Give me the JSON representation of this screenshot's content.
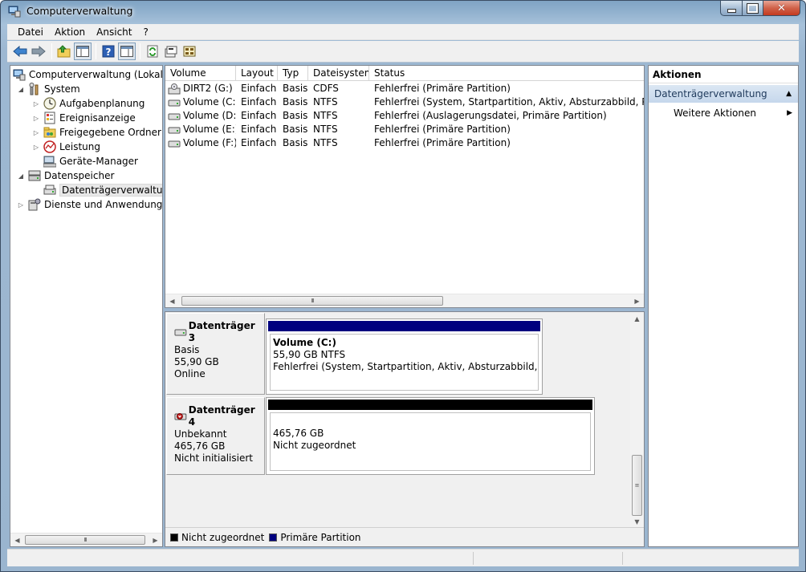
{
  "window": {
    "title": "Computerverwaltung",
    "colors": {
      "frame": "#9ab5cf",
      "close": "#c43a20",
      "primary_partition": "#00007f",
      "unallocated": "#000000"
    }
  },
  "menu": [
    "Datei",
    "Aktion",
    "Ansicht",
    "?"
  ],
  "toolbar": {
    "buttons": [
      "back-arrow-icon",
      "forward-arrow-icon",
      "up-folder-icon",
      "show-hide-tree-icon",
      "help-icon",
      "view-icon",
      "refresh-icon",
      "properties-icon",
      "disk-settings-icon"
    ]
  },
  "tree": {
    "root": "Computerverwaltung (Lokal)",
    "system": "System",
    "aufgabenplanung": "Aufgabenplanung",
    "ereignisanzeige": "Ereignisanzeige",
    "freigegebene_ordner": "Freigegebene Ordner",
    "leistung": "Leistung",
    "geraete_manager": "Geräte-Manager",
    "datenspeicher": "Datenspeicher",
    "datentraegerverwaltung": "Datenträgerverwaltung",
    "dienste": "Dienste und Anwendungen"
  },
  "volumes": {
    "columns": [
      "Volume",
      "Layout",
      "Typ",
      "Dateisystem",
      "Status"
    ],
    "rows": [
      [
        "DIRT2 (G:)",
        "Einfach",
        "Basis",
        "CDFS",
        "Fehlerfrei (Primäre Partition)"
      ],
      [
        "Volume (C:)",
        "Einfach",
        "Basis",
        "NTFS",
        "Fehlerfrei (System, Startpartition, Aktiv, Absturzabbild, Primäre P"
      ],
      [
        "Volume (D:)",
        "Einfach",
        "Basis",
        "NTFS",
        "Fehlerfrei (Auslagerungsdatei, Primäre Partition)"
      ],
      [
        "Volume (E:)",
        "Einfach",
        "Basis",
        "NTFS",
        "Fehlerfrei (Primäre Partition)"
      ],
      [
        "Volume (F:)",
        "Einfach",
        "Basis",
        "NTFS",
        "Fehlerfrei (Primäre Partition)"
      ]
    ]
  },
  "disks": [
    {
      "name": "Datenträger 3",
      "type": "Basis",
      "size": "55,90 GB",
      "state": "Online",
      "partition": {
        "title": "Volume  (C:)",
        "size_fs": "55,90 GB NTFS",
        "status": "Fehlerfrei (System, Startpartition, Aktiv, Absturzabbild, Primäre"
      }
    },
    {
      "name": "Datenträger 4",
      "type": "Unbekannt",
      "size": "465,76 GB",
      "state": "Nicht initialisiert",
      "partition": {
        "size": "465,76 GB",
        "status": "Nicht zugeordnet"
      }
    }
  ],
  "legend": [
    "Nicht zugeordnet",
    "Primäre Partition"
  ],
  "actions": {
    "header": "Aktionen",
    "section": "Datenträgerverwaltung",
    "more": "Weitere Aktionen"
  },
  "scroll_glyph": "III"
}
